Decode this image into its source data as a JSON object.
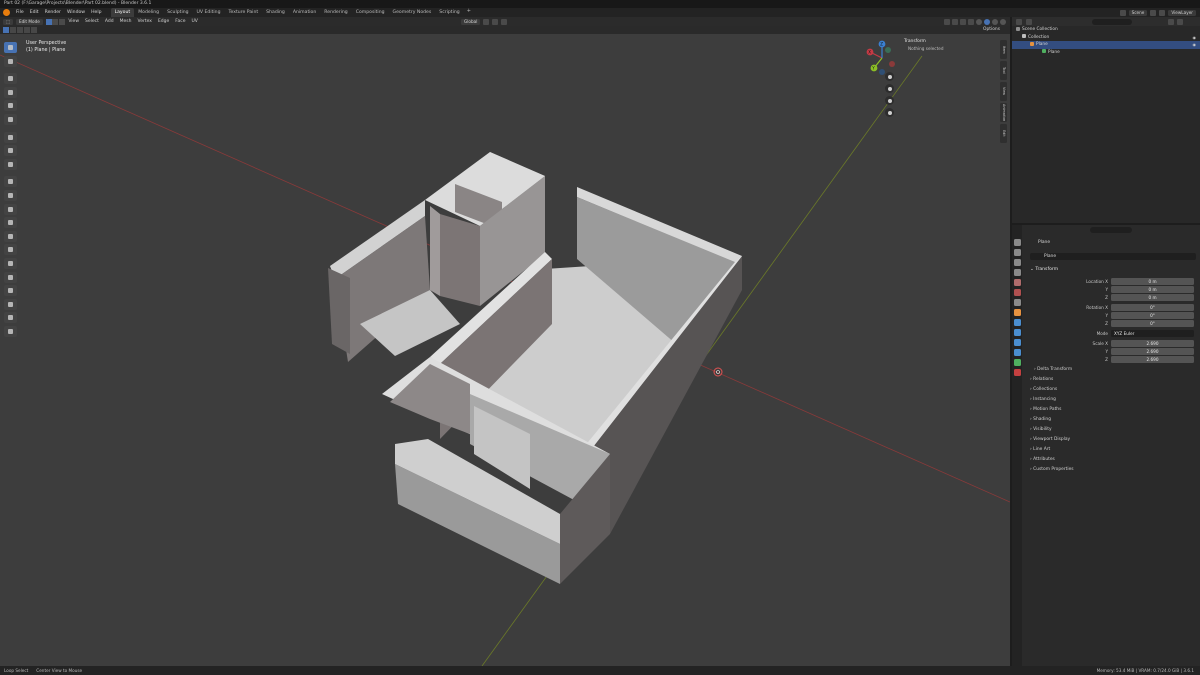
{
  "title_bar": "Part 02 (F:\\Garage\\Projects\\Blender\\Part 02.blend) - Blender 3.6.1",
  "menu": [
    "File",
    "Edit",
    "Render",
    "Window",
    "Help"
  ],
  "workspaces": [
    {
      "label": "Layout",
      "active": true
    },
    {
      "label": "Modeling"
    },
    {
      "label": "Sculpting"
    },
    {
      "label": "UV Editing"
    },
    {
      "label": "Texture Paint"
    },
    {
      "label": "Shading"
    },
    {
      "label": "Animation"
    },
    {
      "label": "Rendering"
    },
    {
      "label": "Compositing"
    },
    {
      "label": "Geometry Nodes"
    },
    {
      "label": "Scripting"
    }
  ],
  "workspace_add": "+",
  "top_right": {
    "scene": "Scene",
    "view_layer": "ViewLayer"
  },
  "viewport_header": {
    "mode": "Edit Mode",
    "menus": [
      "View",
      "Select",
      "Add",
      "Mesh",
      "Vertex",
      "Edge",
      "Face",
      "UV"
    ],
    "orientation": "Global",
    "options": "Options"
  },
  "viewport": {
    "info_line1": "User Perspective",
    "info_line2": "(1) Plane | Plane",
    "axis_colors": {
      "x": "#c53a45",
      "y": "#8cbf26",
      "z": "#3a80d1"
    },
    "gizmo_labels": {
      "x": "X",
      "y": "Y",
      "z": "Z"
    }
  },
  "sidebar": {
    "panel_title": "Transform",
    "message": "Nothing selected",
    "tabs": [
      "Item",
      "Tool",
      "View",
      "Animation",
      "Edit"
    ]
  },
  "outliner": {
    "search_placeholder": "",
    "rows": [
      {
        "label": "Scene Collection",
        "indent": 0,
        "color": "#8e8e8e"
      },
      {
        "label": "Collection",
        "indent": 1,
        "color": "#bdbdbd"
      },
      {
        "label": "Plane",
        "indent": 2,
        "color": "#e69240",
        "selected": true
      },
      {
        "label": "Plane",
        "indent": 3,
        "color": "#4fb060"
      }
    ]
  },
  "properties": {
    "object_name": "Plane",
    "name_field": "Plane",
    "transform_label": "Transform",
    "location": {
      "label_x": "Location X",
      "label_y": "Y",
      "label_z": "Z",
      "x": "0 m",
      "y": "0 m",
      "z": "0 m"
    },
    "rotation": {
      "label_x": "Rotation X",
      "label_y": "Y",
      "label_z": "Z",
      "x": "0°",
      "y": "0°",
      "z": "0°"
    },
    "mode": {
      "label": "Mode",
      "value": "XYZ Euler"
    },
    "scale": {
      "label_x": "Scale X",
      "label_y": "Y",
      "label_z": "Z",
      "x": "2.690",
      "y": "2.690",
      "z": "2.690"
    },
    "subpanels": [
      "Delta Transform",
      "Relations",
      "Collections",
      "Instancing",
      "Motion Paths",
      "Shading",
      "Visibility",
      "Viewport Display",
      "Line Art",
      "Attributes",
      "Custom Properties"
    ]
  },
  "status_bar": {
    "left": [
      "Loop Select",
      "Center View to Mouse"
    ],
    "right": "Memory: 53.4 MiB | VRAM: 0.7/24.0 GiB | 3.6.1"
  }
}
